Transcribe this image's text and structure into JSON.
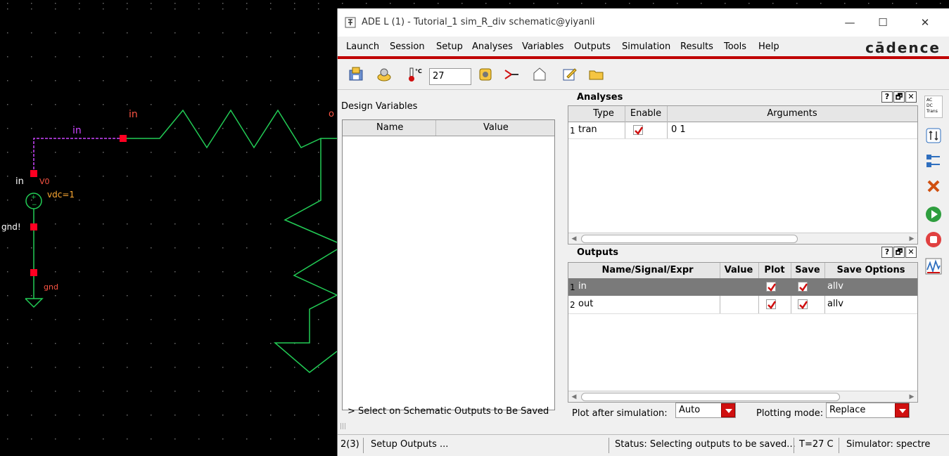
{
  "schematic": {
    "labels": {
      "net_in_top": "in",
      "net_in_wire": "in",
      "pin_in": "in",
      "source_name": "V0",
      "source_value": "vdc=1",
      "gnd_net": "gnd!",
      "gnd_symbol": "gnd",
      "edge_text": "o"
    },
    "colors": {
      "wire": "#22cc55",
      "pin": "#ff0022",
      "label": "#ff5544",
      "highlight": "#cc44ff",
      "text": "#ffffff",
      "orange": "#ffaa33",
      "dot": "#6b6b6b"
    }
  },
  "window": {
    "title": "ADE L (1) - Tutorial_1 sim_R_div schematic@yiyanli",
    "controls": {
      "minimize": "—",
      "maximize": "☐",
      "close": "✕"
    },
    "menu": [
      "Launch",
      "Session",
      "Setup",
      "Analyses",
      "Variables",
      "Outputs",
      "Simulation",
      "Results",
      "Tools",
      "Help"
    ],
    "brand": "cādence",
    "toolbar": {
      "temperature_value": "27",
      "temperature_icon": "thermometer-icon"
    },
    "design_variables": {
      "label": "Design Variables",
      "columns": [
        "Name",
        "Value"
      ],
      "hint": "> Select on Schematic Outputs to Be Saved"
    },
    "analyses": {
      "title": "Analyses",
      "dock_buttons": [
        "?",
        "🗗",
        "✕"
      ],
      "columns": [
        "Type",
        "Enable",
        "Arguments"
      ],
      "rows": [
        {
          "num": "1",
          "type": "tran",
          "enabled": true,
          "args": "0 1"
        }
      ]
    },
    "outputs": {
      "title": "Outputs",
      "dock_buttons": [
        "?",
        "🗗",
        "✕"
      ],
      "columns": [
        "Name/Signal/Expr",
        "Value",
        "Plot",
        "Save",
        "Save Options"
      ],
      "rows": [
        {
          "num": "1",
          "name": "in",
          "value": "",
          "plot": true,
          "save": true,
          "options": "allv",
          "selected": true
        },
        {
          "num": "2",
          "name": "out",
          "value": "",
          "plot": true,
          "save": true,
          "options": "allv",
          "selected": false
        }
      ],
      "plot_after_label": "Plot after simulation:",
      "plot_after_value": "Auto",
      "plotting_mode_label": "Plotting mode:",
      "plotting_mode_value": "Replace"
    },
    "sidebar": {
      "analysis_types": [
        "AC",
        "DC",
        "Trans"
      ]
    },
    "status": {
      "count": "2(3)",
      "message": "Setup Outputs ...",
      "status_text": "Status: Selecting outputs to be saved...",
      "temp": "T=27 C",
      "simulator": "Simulator: spectre"
    },
    "colors": {
      "accent_red": "#c00000",
      "selected_row": "#7a7a7a",
      "check_red": "#d01010"
    }
  }
}
